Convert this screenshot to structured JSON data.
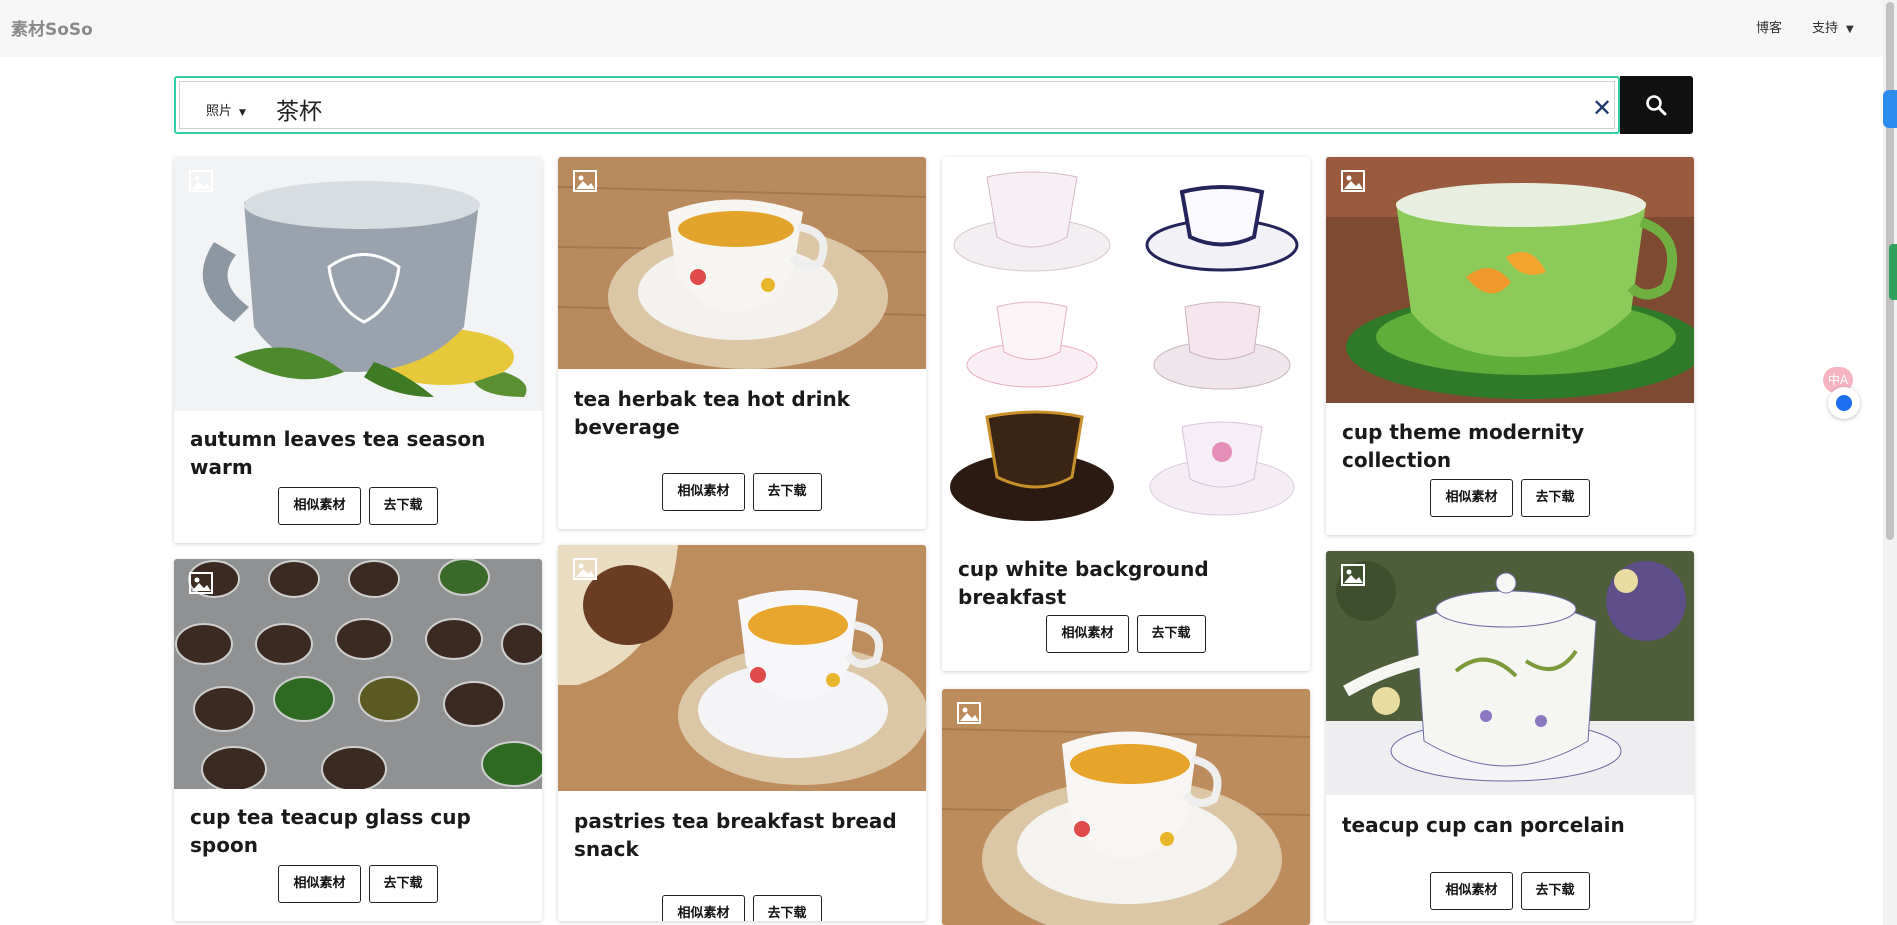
{
  "header": {
    "logo": "素材SoSo",
    "nav_blog": "博客",
    "nav_support": "支持"
  },
  "search": {
    "type": "照片",
    "query": "茶杯"
  },
  "buttons": {
    "similar": "相似素材",
    "download": "去下载"
  },
  "side_widget": {
    "label": "中A"
  },
  "cards": [
    {
      "title": "autumn leaves tea season warm"
    },
    {
      "title": "tea herbak tea hot drink beverage"
    },
    {
      "title": "cup white background breakfast"
    },
    {
      "title": "cup theme modernity collection"
    },
    {
      "title": "cup tea teacup glass cup spoon"
    },
    {
      "title": "pastries tea breakfast bread snack"
    },
    {
      "title": ""
    },
    {
      "title": "teacup cup can porcelain"
    }
  ]
}
